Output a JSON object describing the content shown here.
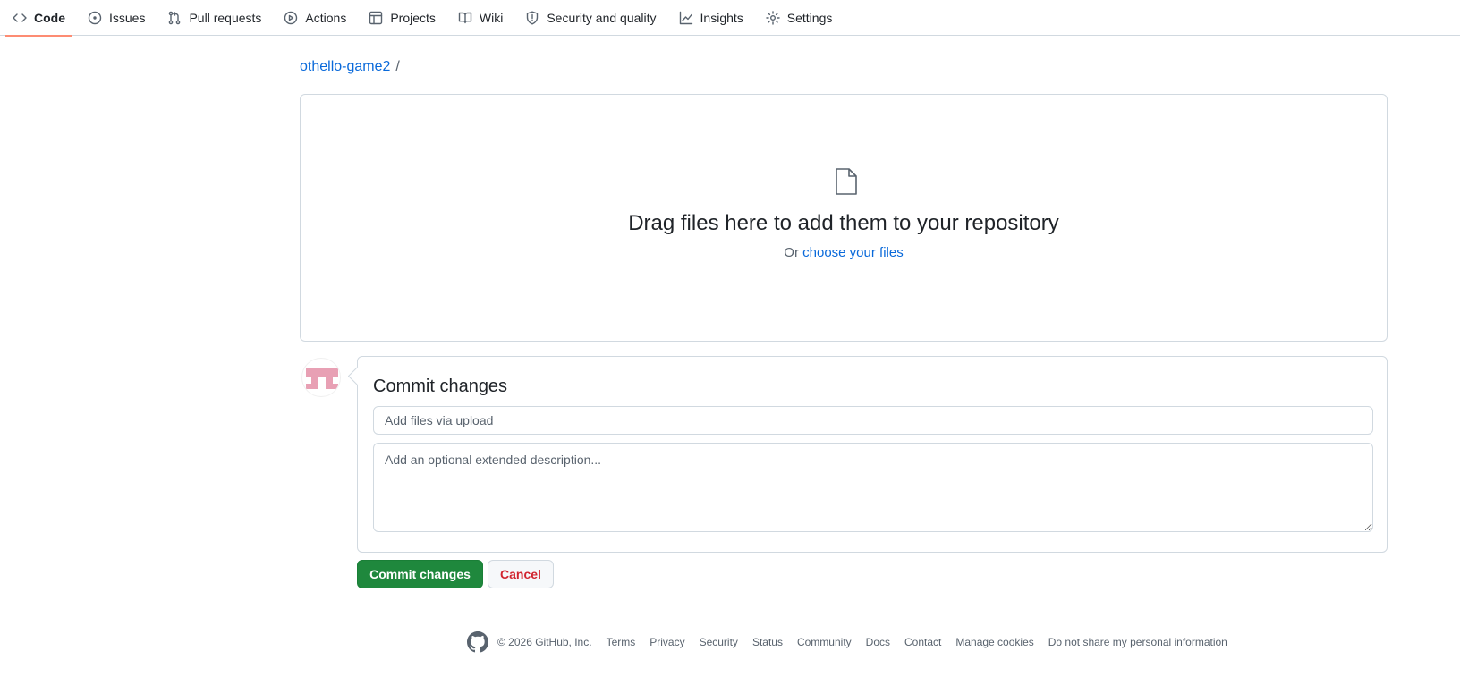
{
  "nav": {
    "tabs": [
      {
        "label": "Code",
        "icon": "code-icon",
        "active": true
      },
      {
        "label": "Issues",
        "icon": "issue-opened-icon",
        "active": false
      },
      {
        "label": "Pull requests",
        "icon": "git-pull-request-icon",
        "active": false
      },
      {
        "label": "Actions",
        "icon": "play-icon",
        "active": false
      },
      {
        "label": "Projects",
        "icon": "table-icon",
        "active": false
      },
      {
        "label": "Wiki",
        "icon": "book-icon",
        "active": false
      },
      {
        "label": "Security and quality",
        "icon": "shield-icon",
        "active": false
      },
      {
        "label": "Insights",
        "icon": "graph-icon",
        "active": false
      },
      {
        "label": "Settings",
        "icon": "gear-icon",
        "active": false
      }
    ]
  },
  "breadcrumb": {
    "repo": "othello-game2",
    "separator": "/"
  },
  "dropzone": {
    "title": "Drag files here to add them to your repository",
    "or_text": "Or",
    "choose_link": "choose your files"
  },
  "commit": {
    "heading": "Commit changes",
    "summary_placeholder": "Add files via upload",
    "description_placeholder": "Add an optional extended description...",
    "submit_label": "Commit changes",
    "cancel_label": "Cancel"
  },
  "footer": {
    "copyright": "© 2026 GitHub, Inc.",
    "links": [
      "Terms",
      "Privacy",
      "Security",
      "Status",
      "Community",
      "Docs",
      "Contact",
      "Manage cookies",
      "Do not share my personal information"
    ]
  },
  "colors": {
    "accent_link": "#0969da",
    "primary_button": "#1f883d",
    "cancel_text": "#d1242f",
    "active_tab_underline": "#fd8c73",
    "avatar_pink": "#e8a0b4"
  }
}
